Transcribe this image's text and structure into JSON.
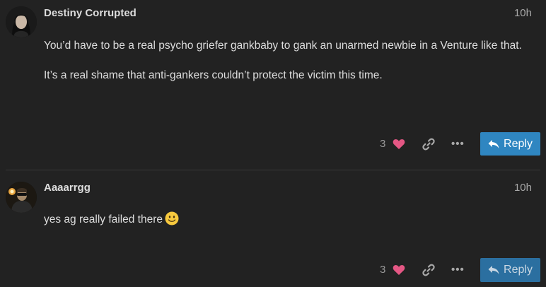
{
  "posts": [
    {
      "username": "Destiny Corrupted",
      "time": "10h",
      "paragraphs": [
        "You’d have to be a real psycho griefer gankbaby to gank an unarmed newbie in a Venture like that.",
        "It’s a real shame that anti-gankers couldn’t protect the victim this time."
      ],
      "likes": "3",
      "reply_label": "Reply"
    },
    {
      "username": "Aaaarrgg",
      "time": "10h",
      "text": "yes ag really failed there",
      "likes": "3",
      "reply_label": "Reply"
    }
  ],
  "colors": {
    "background": "#222222",
    "accent": "#2f86c1",
    "heart": "#e45784"
  },
  "icons": [
    "heart-icon",
    "link-icon",
    "more-icon",
    "reply-arrow-icon",
    "slightly-smiling-face-emoji"
  ]
}
